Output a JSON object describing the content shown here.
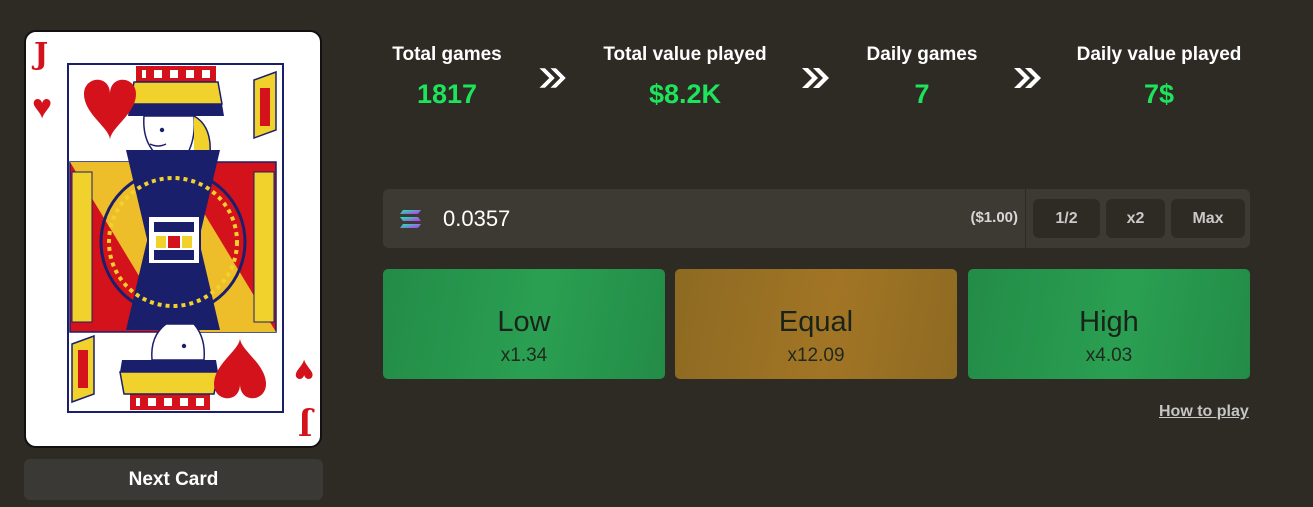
{
  "card": {
    "rank": "J",
    "suit_symbol": "♥",
    "suit_color": "#d3121c"
  },
  "next_card_label": "Next Card",
  "stats": [
    {
      "label": "Total games",
      "value": "1817"
    },
    {
      "label": "Total value played",
      "value": "$8.2K"
    },
    {
      "label": "Daily games",
      "value": "7"
    },
    {
      "label": "Daily value played",
      "value": "7$"
    }
  ],
  "bet": {
    "currency_icon": "solana-icon",
    "amount": "0.0357",
    "usd_value": "($1.00)",
    "half_label": "1/2",
    "double_label": "x2",
    "max_label": "Max"
  },
  "choices": {
    "low": {
      "label": "Low",
      "multiplier": "x1.34"
    },
    "equal": {
      "label": "Equal",
      "multiplier": "x12.09"
    },
    "high": {
      "label": "High",
      "multiplier": "x4.03"
    }
  },
  "how_to_play": "How to play",
  "colors": {
    "background": "#2e2b25",
    "stat_value": "#1de45b",
    "green_button": "#2a9f52",
    "gold_button": "#a27525",
    "bet_bar": "#3d3a33"
  }
}
